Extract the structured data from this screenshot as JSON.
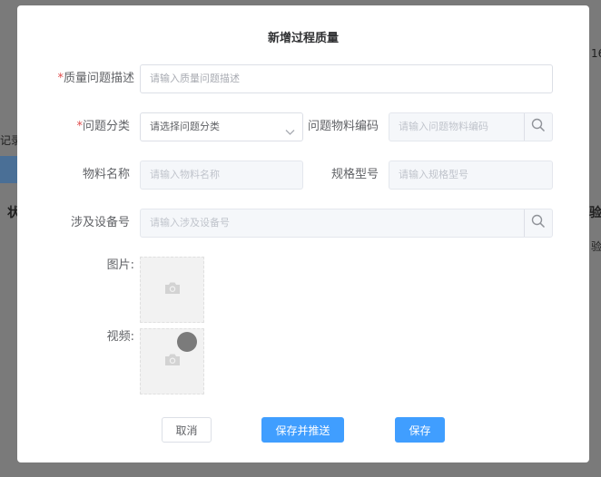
{
  "background": {
    "fragment_1": "16",
    "fragment_2": "记录",
    "fragment_3": "状",
    "fragment_4": "验",
    "fragment_5": "验"
  },
  "dialog": {
    "title": "新增过程质量",
    "required_mark": "*",
    "fields": {
      "issue_description": {
        "label": "质量问题描述",
        "placeholder": "请输入质量问题描述"
      },
      "issue_category": {
        "label": "问题分类",
        "value": "请选择问题分类"
      },
      "material_code": {
        "label": "问题物料编码",
        "placeholder": "请输入问题物料编码"
      },
      "material_name": {
        "label": "物料名称",
        "placeholder": "请输入物料名称"
      },
      "spec_model": {
        "label": "规格型号",
        "placeholder": "请输入规格型号"
      },
      "equipment_no": {
        "label": "涉及设备号",
        "placeholder": "请输入涉及设备号"
      },
      "image": {
        "label": "图片:"
      },
      "video": {
        "label": "视频:"
      }
    },
    "buttons": {
      "cancel": "取消",
      "save_and_push": "保存并推送",
      "save": "保存"
    }
  },
  "colors": {
    "primary": "#409eff",
    "required": "#e04b4b",
    "overlay": "#7a7a7a"
  },
  "icons": [
    "search-icon",
    "chevron-down-icon",
    "camera-icon"
  ]
}
